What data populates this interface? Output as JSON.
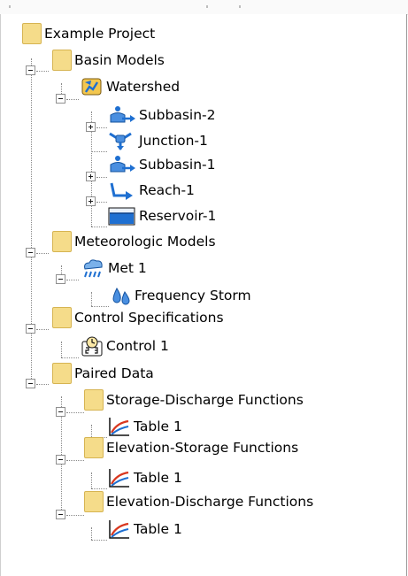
{
  "tree": {
    "root": {
      "label": "Example Project",
      "icon": "folder-icon"
    },
    "basin_models": {
      "label": "Basin Models",
      "icon": "folder-icon",
      "watershed": {
        "label": "Watershed",
        "icon": "basin-model-icon"
      },
      "elements": [
        {
          "label": "Subbasin-2",
          "icon": "subbasin-icon"
        },
        {
          "label": "Junction-1",
          "icon": "junction-icon"
        },
        {
          "label": "Subbasin-1",
          "icon": "subbasin-icon"
        },
        {
          "label": "Reach-1",
          "icon": "reach-icon"
        },
        {
          "label": "Reservoir-1",
          "icon": "reservoir-icon"
        }
      ]
    },
    "meteorologic_models": {
      "label": "Meteorologic Models",
      "icon": "folder-icon",
      "met": {
        "label": "Met 1",
        "icon": "met-model-icon"
      },
      "storm": {
        "label": "Frequency Storm",
        "icon": "precipitation-icon"
      }
    },
    "control_specifications": {
      "label": "Control Specifications",
      "icon": "folder-icon",
      "control": {
        "label": "Control 1",
        "icon": "control-clock-icon"
      }
    },
    "paired_data": {
      "label": "Paired Data",
      "icon": "folder-icon",
      "groups": [
        {
          "label": "Storage-Discharge Functions",
          "table": "Table 1"
        },
        {
          "label": "Elevation-Storage Functions",
          "table": "Table 1"
        },
        {
          "label": "Elevation-Discharge Functions",
          "table": "Table 1"
        }
      ]
    }
  },
  "colors": {
    "folder": "#f5dc8a",
    "folder_border": "#d6b452",
    "water": "#1e6fd1",
    "chart_red": "#d9371f"
  }
}
